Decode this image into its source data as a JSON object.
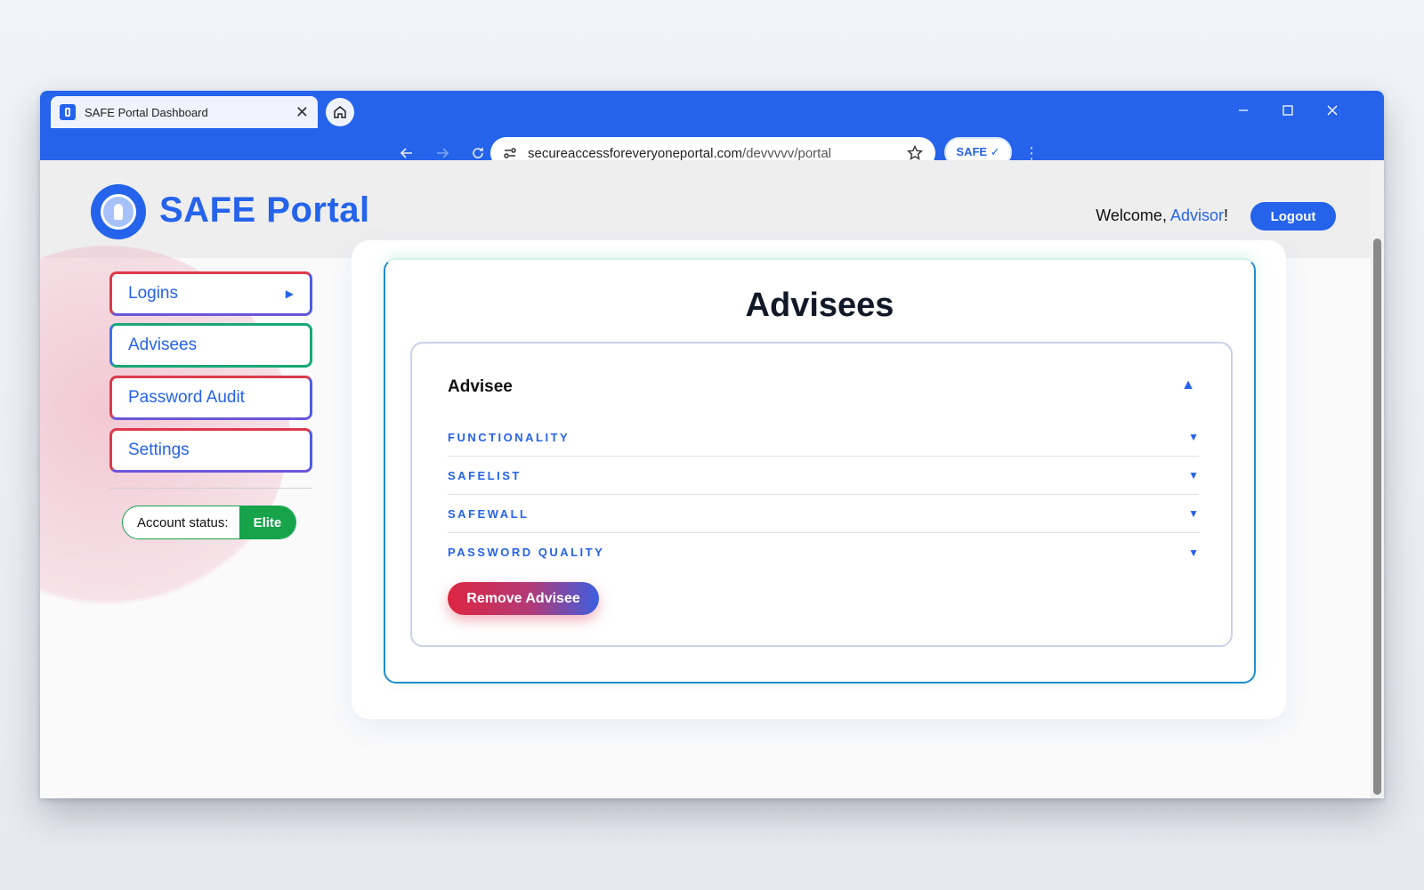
{
  "browser": {
    "tab_title": "SAFE Portal Dashboard",
    "url_host": "secureaccessforeveryoneportal.com",
    "url_path": "/devvvvv/portal",
    "extension_label": "SAFE ✓"
  },
  "header": {
    "logo_text": "SAFE Portal",
    "welcome_prefix": "Welcome, ",
    "welcome_user": "Advisor",
    "welcome_suffix": "!",
    "logout_label": "Logout"
  },
  "sidebar": {
    "items": [
      {
        "label": "Logins",
        "arrow": "▶"
      },
      {
        "label": "Advisees"
      },
      {
        "label": "Password Audit"
      },
      {
        "label": "Settings"
      }
    ],
    "status_label": "Account status:",
    "status_value": "Elite"
  },
  "main": {
    "title": "Advisees",
    "advisee": {
      "name": "Advisee",
      "toggle": "▲",
      "sections": [
        {
          "label": "FUNCTIONALITY",
          "caret": "▼"
        },
        {
          "label": "SAFELIST",
          "caret": "▼"
        },
        {
          "label": "SAFEWALL",
          "caret": "▼"
        },
        {
          "label": "PASSWORD QUALITY",
          "caret": "▼"
        }
      ],
      "remove_label": "Remove Advisee"
    }
  },
  "colors": {
    "brand": "#2563eb",
    "status_green": "#16a34a",
    "danger": "#dc2640"
  }
}
